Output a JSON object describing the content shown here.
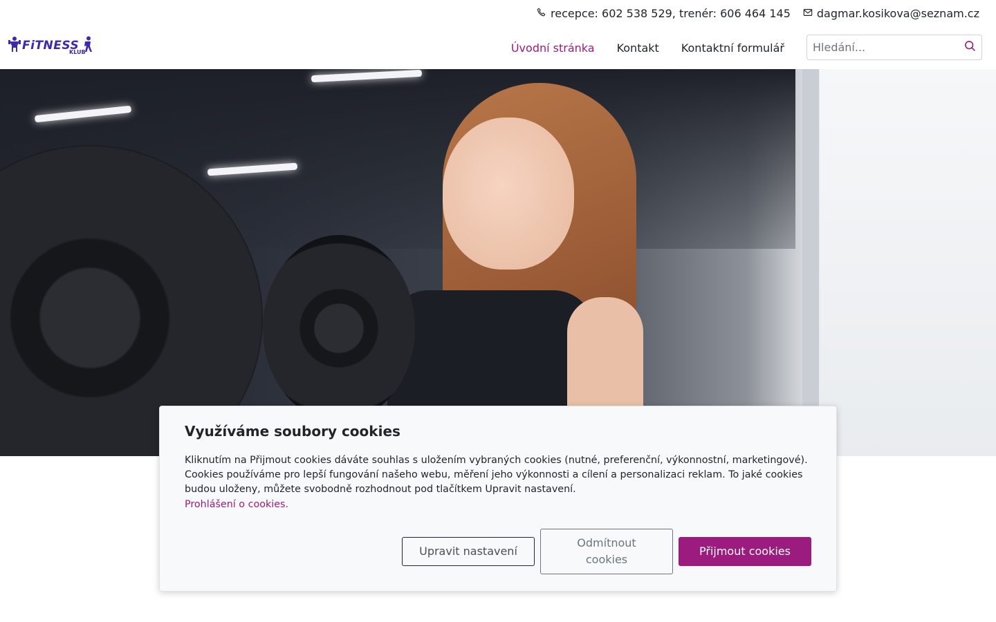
{
  "topbar": {
    "phone_text": "recepce: 602 538 529, trenér: 606 464 145",
    "email_text": "dagmar.kosikova@seznam.cz"
  },
  "logo": {
    "word": "FiTNESS",
    "sub": "KLUB"
  },
  "nav": {
    "items": [
      {
        "label": "Úvodní stránka",
        "active": true
      },
      {
        "label": "Kontakt",
        "active": false
      },
      {
        "label": "Kontaktní formulář",
        "active": false
      }
    ]
  },
  "search": {
    "placeholder": "Hledání..."
  },
  "cookie": {
    "title": "Využíváme soubory cookies",
    "body": "Kliknutím na Přijmout cookies dáváte souhlas s uložením vybraných cookies (nutné, preferenční, výkonnostní, marketingové). Cookies používáme pro lepší fungování našeho webu, měření jeho výkonnosti a cílení a personalizaci reklam. To jaké cookies budou uloženy, můžete svobodně rozhodnout pod tlačítkem Upravit nastavení.",
    "link": "Prohlášení o cookies.",
    "btn_settings": "Upravit nastavení",
    "btn_reject": "Odmítnout cookies",
    "btn_accept": "Přijmout cookies"
  },
  "colors": {
    "accent": "#9b1b7e",
    "logo": "#3d2aa8",
    "text": "#212529"
  }
}
